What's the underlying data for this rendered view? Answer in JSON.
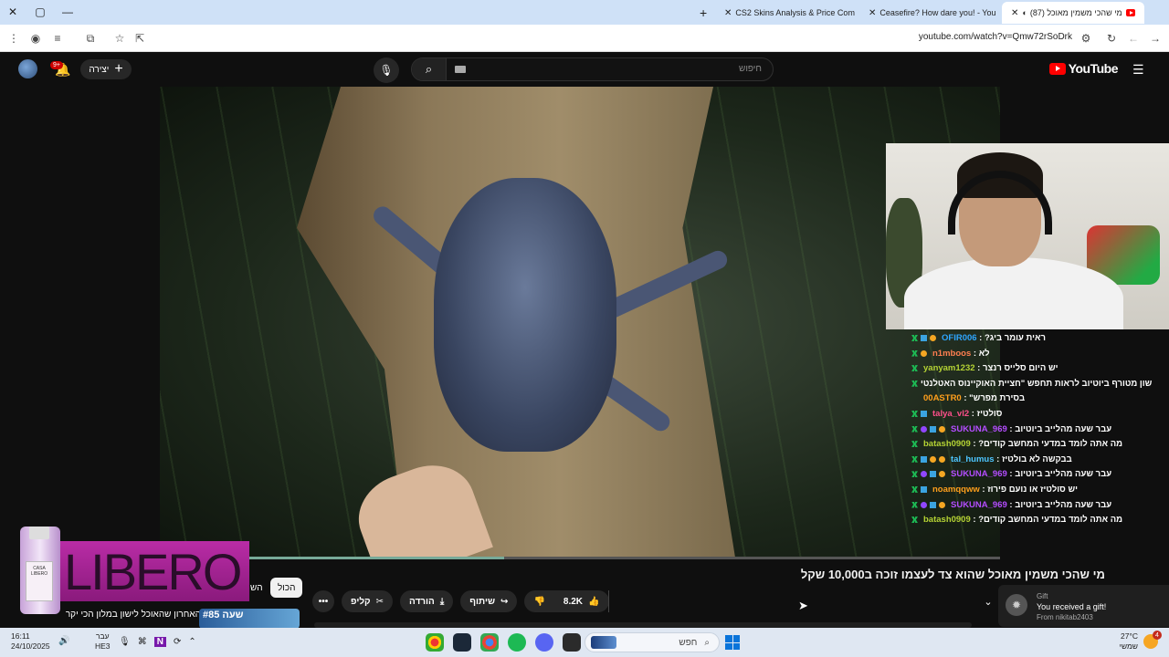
{
  "browser": {
    "tabs": [
      {
        "title": "CS2 Skins Analysis & Price Com",
        "favicon": "dark-square-icon"
      },
      {
        "title": "Ceasefire? How dare you! - You",
        "favicon": "youtube-icon"
      },
      {
        "title": "(87) מי שהכי משמין מאוכל",
        "favicon": "youtube-icon",
        "active": true
      }
    ],
    "url": "youtube.com/watch?v=Qmw72rSoDrk"
  },
  "youtube": {
    "notification_count": "9+",
    "create_label": "יצירה",
    "search_placeholder": "חיפוש",
    "logo_text": "YouTube",
    "video_title": "מי שהכי משמין מאוכל שהוא צד לעצמו זוכה ב10,000 שקל",
    "likes": "8.2K",
    "share_label": "שיתוף",
    "download_label": "הורדה",
    "clip_label": "קליפ",
    "more_label": "•••",
    "filter_all": "הכול",
    "filter_partial": "הש",
    "watch_progress": 0.41,
    "sidebar_rank": "#85",
    "sidebar_prefix": "שעה",
    "sidebar_video": "האחרון שהאוכל לישון במלון הכי יקר"
  },
  "chat": [
    {
      "user": "OFIR006",
      "color": "#2ea6ff",
      "msg": "ראית עומר ביג?",
      "badges": [
        "g",
        "b",
        "o"
      ]
    },
    {
      "user": "n1mboos",
      "color": "#ff7f50",
      "msg": "לא",
      "badges": [
        "g",
        "o"
      ]
    },
    {
      "user": "yanyam1232",
      "color": "#b5d334",
      "msg": "יש היום סלייס רנצר",
      "badges": [
        "g"
      ]
    },
    {
      "user": "00ASTR0",
      "color": "#ff9f1c",
      "msg": "שון מטורף ביוטיוב לראות תחפש \"חציית האוקיינוס האטלנטי בסירת מפרש\"",
      "badges": [
        "g"
      ]
    },
    {
      "user": "talya_vl2",
      "color": "#ff4f8b",
      "msg": "סולטיז",
      "badges": [
        "g",
        "b"
      ]
    },
    {
      "user": "SUKUNA_969",
      "color": "#b44dff",
      "msg": "עבר שעה מהלייב ביוטיוב",
      "badges": [
        "g",
        "p",
        "b",
        "o"
      ]
    },
    {
      "user": "batash0909",
      "color": "#b5d334",
      "msg": "מה אתה לומד במדעי המחשב קודים?",
      "badges": [
        "g"
      ]
    },
    {
      "user": "tal_humus",
      "color": "#4dc6ff",
      "msg": "בבקשה לא בולטיז",
      "badges": [
        "g",
        "b",
        "o",
        "o"
      ]
    },
    {
      "user": "SUKUNA_969",
      "color": "#b44dff",
      "msg": "עבר שעה מהלייב ביוטיוב",
      "badges": [
        "g",
        "p",
        "b",
        "o"
      ]
    },
    {
      "user": "noamqqww",
      "color": "#ff9f1c",
      "msg": "יש סולטיז או נועם פירוז",
      "badges": [
        "g",
        "b"
      ]
    },
    {
      "user": "SUKUNA_969",
      "color": "#b44dff",
      "msg": "עבר שעה מהלייב ביוטיוב",
      "badges": [
        "g",
        "p",
        "b",
        "o"
      ]
    },
    {
      "user": "batash0909",
      "color": "#b5d334",
      "msg": "מה אתה לומד במדעי המחשב קודים?",
      "badges": [
        "g"
      ]
    }
  ],
  "ad": {
    "brand": "LIBERO",
    "bottle_label": "CASA LIBERO"
  },
  "gift": {
    "title": "Gift",
    "text": "You received a gift!",
    "from": "From nikitab2403"
  },
  "taskbar": {
    "time": "16:11",
    "date": "24/10/2025",
    "lang_top": "עבר",
    "lang_bottom": "HE3",
    "search_label": "חפש",
    "temp": "27°C",
    "weather_text": "שמשי",
    "weather_badge": "4"
  }
}
